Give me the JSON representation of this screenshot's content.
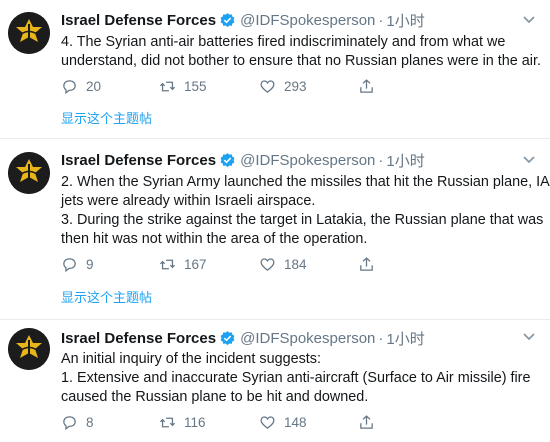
{
  "tweets": [
    {
      "name": "Israel Defense Forces",
      "handle": "@IDFSpokesperson",
      "separator": "·",
      "time": "1小时",
      "lines": [
        "4. The Syrian anti-air batteries fired indiscriminately and from what we",
        "understand, did not bother to ensure that no Russian planes were in the air."
      ],
      "replies": "20",
      "retweets": "155",
      "likes": "293",
      "thread_link": "显示这个主题帖"
    },
    {
      "name": "Israel Defense Forces",
      "handle": "@IDFSpokesperson",
      "separator": "·",
      "time": "1小时",
      "lines": [
        "2. When the Syrian Army launched the missiles that hit the Russian plane, IAF",
        "jets were already within Israeli airspace.",
        "3. During the strike against the target in Latakia, the Russian plane that was",
        "then hit was not within the area of the operation."
      ],
      "replies": "9",
      "retweets": "167",
      "likes": "184",
      "thread_link": "显示这个主题帖"
    },
    {
      "name": "Israel Defense Forces",
      "handle": "@IDFSpokesperson",
      "separator": "·",
      "time": "1小时",
      "lines": [
        "An initial inquiry of the incident suggests:",
        "1. Extensive and inaccurate Syrian anti-aircraft (Surface to Air missile) fire",
        "caused the Russian plane to be hit and downed."
      ],
      "replies": "8",
      "retweets": "116",
      "likes": "148"
    }
  ],
  "icons": {
    "avatar": "idf-logo-icon",
    "verified": "verified-badge-icon",
    "caret": "chevron-down-icon",
    "reply": "reply-icon",
    "retweet": "retweet-icon",
    "like": "heart-icon",
    "share": "share-icon"
  },
  "colors": {
    "link": "#1da1f2",
    "secondary_text": "#657786",
    "primary_text": "#14171a",
    "divider": "#e6ecf0",
    "logo_gold": "#e8b51a"
  }
}
